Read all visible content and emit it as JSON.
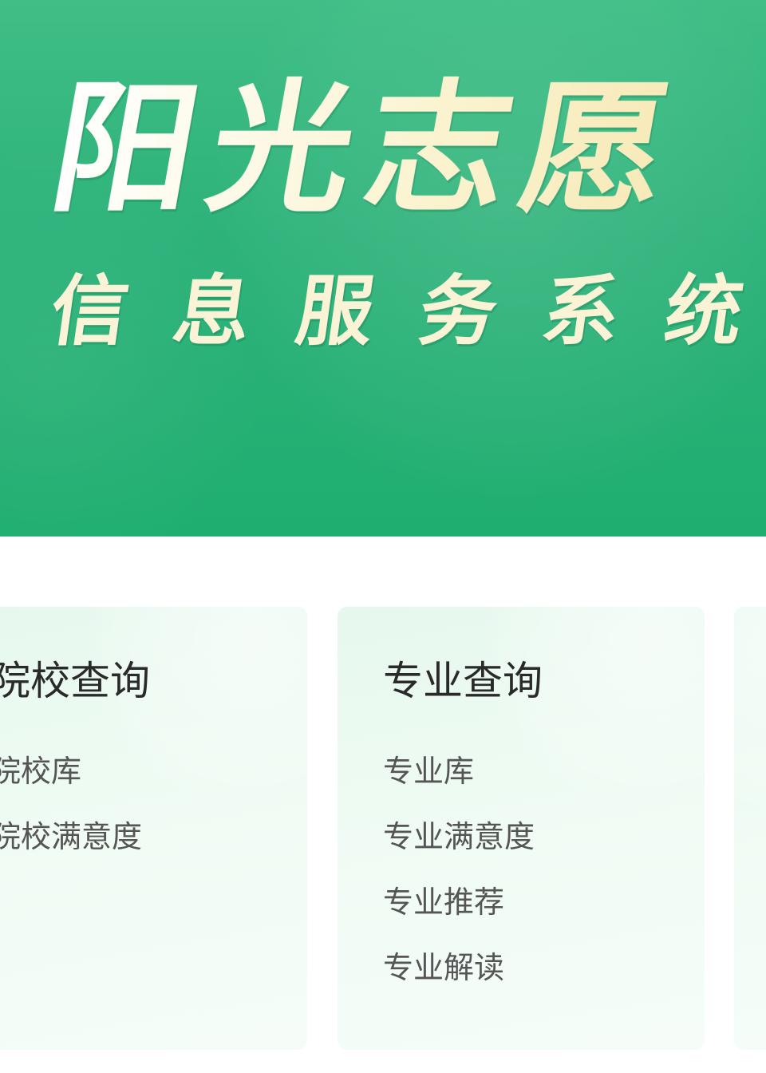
{
  "banner": {
    "title": "阳光志愿",
    "subtitle": "信息服务系统"
  },
  "cards": [
    {
      "title": "院校查询",
      "items": [
        "院校库",
        "院校满意度"
      ]
    },
    {
      "title": "专业查询",
      "items": [
        "专业库",
        "专业满意度",
        "专业推荐",
        "专业解读"
      ]
    }
  ]
}
